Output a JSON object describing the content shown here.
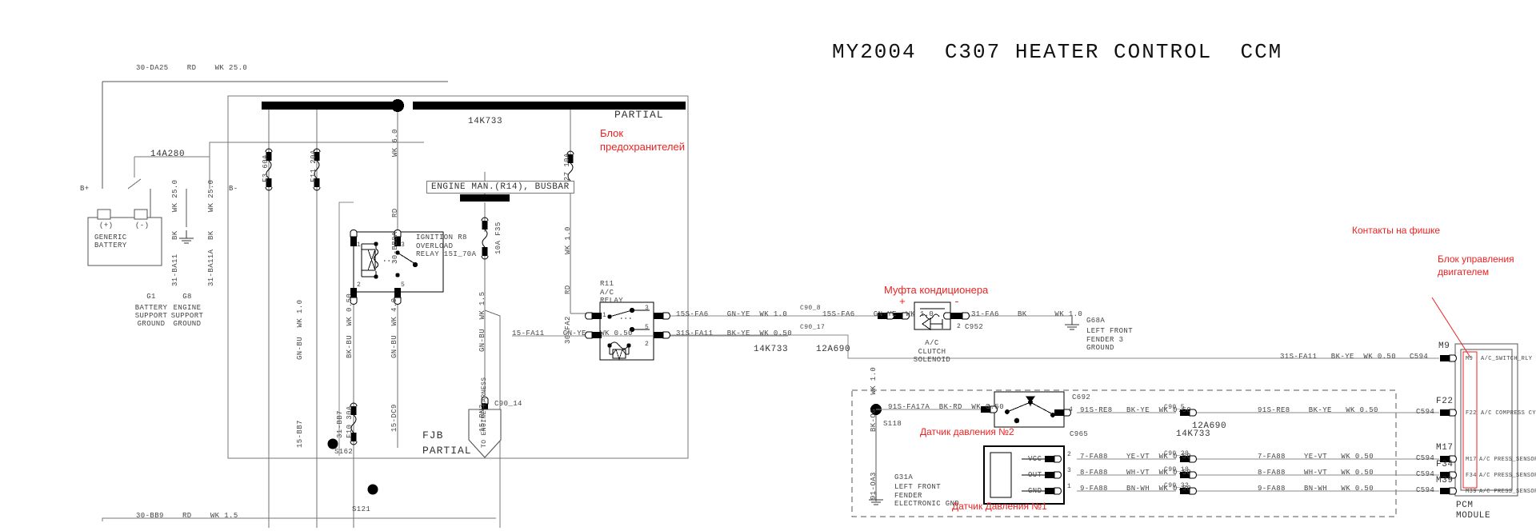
{
  "title": "MY2004  C307 HEATER CONTROL  CCM",
  "annotations_ru": {
    "fuse_block": "Блок\nпредохранителей",
    "ac_clutch": "Муфта кондиционера",
    "pressure_sensor_2": "Датчик давления №2",
    "pressure_sensor_1": "Датчик Давления №1",
    "connector_pins": "Контакты на фишке",
    "ecu_block": "Блок управления\nдвигателем",
    "accent_color": "#ee2222"
  },
  "battery": {
    "name": "GENERIC\nBATTERY",
    "pos_terminal": "B+",
    "neg_terminal": "B-",
    "pos_mark": "(+)",
    "neg_mark": "(-)",
    "harness": "14A280",
    "supply_wire": "30-DA25    RD    WK 25.0",
    "gnd_wire_1": "31-BA11   BK    WK 25.0",
    "gnd_wire_2": "31-BA11A  BK    WK 25.0"
  },
  "grounds": [
    {
      "id": "G1",
      "desc": "BATTERY\nSUPPORT\nGROUND"
    },
    {
      "id": "G8",
      "desc": "ENGINE\nSUPPORT\nGROUND"
    },
    {
      "id": "G68A",
      "desc": "LEFT FRONT\nFENDER 3\nGROUND"
    },
    {
      "id": "G31A",
      "desc": "LEFT FRONT\nFENDER\nELECTRONIC GND"
    }
  ],
  "fjb": {
    "label": "FJB\nPARTIAL",
    "harness": "14K733",
    "busbar_note": "ENGINE MAN.(R14), BUSBAR",
    "partial": "PARTIAL",
    "fuses": [
      {
        "id": "F3",
        "rating": "60A"
      },
      {
        "id": "F11",
        "rating": "20A"
      },
      {
        "id": "F35",
        "rating": "10A"
      },
      {
        "id": "F27",
        "rating": "10A"
      },
      {
        "id": "F10",
        "rating": "30A"
      }
    ],
    "relay": {
      "id": "IGNITION R8",
      "line2": "OVERLOAD",
      "line3": "RELAY 15I_70A",
      "pins": [
        "1",
        "3",
        "2",
        "5"
      ]
    },
    "splices": [
      "S162",
      "S121"
    ],
    "connector_c90_14": "C90_14",
    "harness_tag": "TO ENGINE HARNESS"
  },
  "wires": {
    "w_wk60": "WK 6.0",
    "w_rd": "RD",
    "w_30bb8a": "30-BB8A",
    "w_gnbu10": "GN-BU  WK 1.0",
    "w_15bb7": "15-BB7",
    "w_bkbu050": "BK-BU  WK 0.50",
    "w_31bb7": "31-BB7",
    "w_gnbu40": "GN-BU  WK 4.0",
    "w_15dc9": "15-DC9",
    "w_gnbu15": "GN-BU  WK 1.5",
    "w_15rn3": "15-RN3",
    "w_rd_fa2": "RD",
    "w_30fa2": "30-FA2",
    "w_wk10": "WK 1.0",
    "w_15fa11": "15-FA11    GN-YE   WK 0.50",
    "w_15sfa6a": "15S-FA6    GN-YE  WK 1.0",
    "w_15sfa6b": "15S-FA6    GN-YE  WK 1.0",
    "w_31sfa11": "31S-FA11   BK-YE  WK 0.50",
    "w_31fa6": "31-FA6    BK      WK 1.0",
    "w_31sfa11_pcm": "31S-FA11   BK-YE  WK 0.50",
    "w_91sfa17a": "91S-FA17A  BK-RD  WK 0.50",
    "w_91sre8a": "91S-RE8   BK-YE  WK 0.50",
    "w_91sre8b": "91S-RE8    BK-YE   WK 0.50",
    "w_7fa88a": "7-FA88    YE-VT  WK 0.50",
    "w_8fa88a": "8-FA88    WH-VT  WK 0.50",
    "w_9fa88a": "9-FA88    BN-WH  WK 0.50",
    "w_7fa88b": "7-FA88    YE-VT   WK 0.50",
    "w_8fa88b": "8-FA88    WH-VT   WK 0.50",
    "w_9fa88b": "9-FA88    BN-WH   WK 0.50",
    "w_91oa3": "91-OA3",
    "w_bkog10": "BK-OG   WK 1.0",
    "w_30bb9": "30-BB9    RD    WK 1.5",
    "w_wk15": "WK 1.5"
  },
  "ac_relay": {
    "id": "R11",
    "line2": "A/C",
    "line3": "RELAY",
    "pins": [
      "1",
      "3",
      "5",
      "2"
    ]
  },
  "ac_clutch": {
    "name": "A/C\nCLUTCH\nSOLENOID",
    "connector": "C952",
    "plus": "+",
    "minus": "-",
    "pin": "2"
  },
  "harness_tags": {
    "h14k733a": "14K733",
    "h14k733b": "14K733",
    "h14k733c": "14K733",
    "h14k733d": "14K733",
    "h12a690a": "12A690",
    "h12a690b": "12A690"
  },
  "connectors": {
    "c90_8": "C90_8",
    "c90_17": "C90_17",
    "c90_5": "C90_5",
    "c90_29": "C90_29",
    "c90_19": "C90_19",
    "c90_32": "C90_32",
    "c594a": "C594",
    "c594b": "C594",
    "c594c": "C594",
    "c594d": "C594",
    "c594e": "C594",
    "c692": "C692",
    "c965": "C965",
    "c952": "C952"
  },
  "splice_s118": "S118",
  "pressure_sensor": {
    "vcc": "VCC",
    "out": "OUT",
    "gnd": "GND",
    "pins": [
      "2",
      "3",
      "1"
    ]
  },
  "pressure_switch": {
    "pin_in": "1",
    "pin_out": "4"
  },
  "pcm": {
    "title": "PCM\nMODULE",
    "pins": [
      {
        "id": "M9",
        "signal": "A/C_SWITCH_RLY"
      },
      {
        "id": "F22",
        "signal": "A/C COMPRESS CYC"
      },
      {
        "id": "M17",
        "signal": "A/C PRESS_SENSOR_SUP"
      },
      {
        "id": "F34",
        "signal": "A/C PRESS_SENSOR_SGN"
      },
      {
        "id": "M39",
        "signal": "A/C PRESS_SENSOR_GND"
      }
    ],
    "outside_labels": [
      "M9",
      "F22",
      "M17",
      "F34",
      "M39"
    ]
  }
}
